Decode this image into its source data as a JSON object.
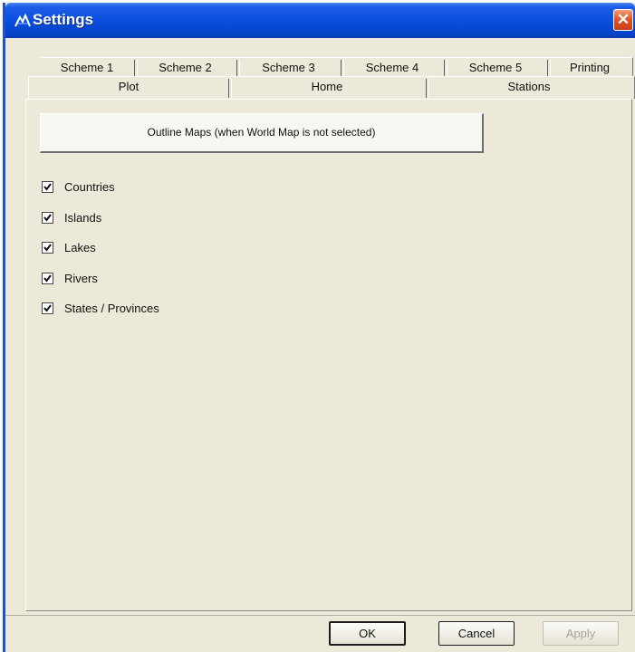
{
  "window": {
    "title": "Settings",
    "close_glyph": "✕",
    "app_icon": "mountain-icon"
  },
  "tabs": {
    "row1": [
      "Scheme 1",
      "Scheme 2",
      "Scheme 3",
      "Scheme 4",
      "Scheme 5",
      "Printing"
    ],
    "row2": [
      "Plot",
      "Home",
      "Stations"
    ],
    "selected": "Plot"
  },
  "plot_panel": {
    "outline_button_label": "Outline Maps (when World Map is not selected)",
    "checkboxes": [
      {
        "label": "Countries",
        "checked": true
      },
      {
        "label": "Islands",
        "checked": true
      },
      {
        "label": "Lakes",
        "checked": true
      },
      {
        "label": "Rivers",
        "checked": true
      },
      {
        "label": "States / Provinces",
        "checked": true
      }
    ]
  },
  "footer": {
    "ok_label": "OK",
    "cancel_label": "Cancel",
    "apply_label": "Apply",
    "apply_enabled": false
  }
}
